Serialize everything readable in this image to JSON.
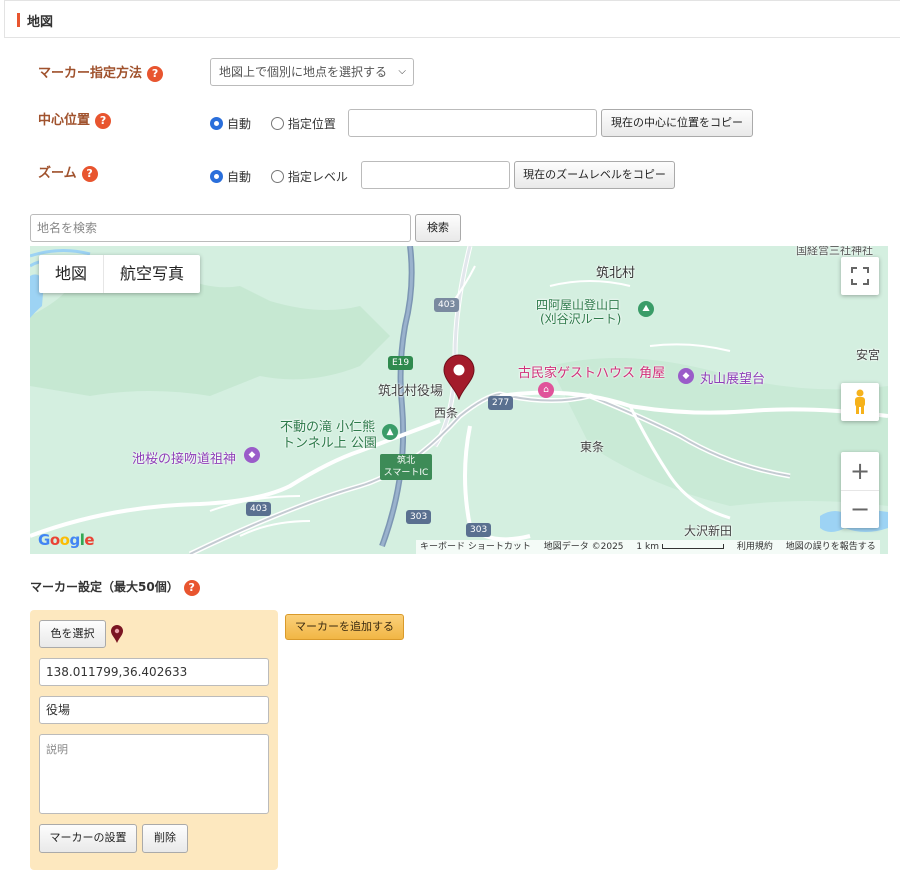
{
  "section": {
    "title": "地図"
  },
  "marker_method": {
    "label": "マーカー指定方法",
    "help": "?",
    "selected": "地図上で個別に地点を選択する"
  },
  "center": {
    "label": "中心位置",
    "help": "?",
    "option_auto": "自動",
    "option_fixed": "指定位置",
    "selected": "自動",
    "value": "",
    "copy_button": "現在の中心に位置をコピー"
  },
  "zoom": {
    "label": "ズーム",
    "help": "?",
    "option_auto": "自動",
    "option_level": "指定レベル",
    "selected": "自動",
    "value": "",
    "copy_button": "現在のズームレベルをコピー"
  },
  "search": {
    "placeholder": "地名を検索",
    "button": "検索"
  },
  "map": {
    "type_map": "地図",
    "type_satellite": "航空写真",
    "zoom_in": "+",
    "zoom_out": "−",
    "labels": {
      "chikuhoku": "筑北村",
      "shiazaya": "四阿屋山登山口",
      "shiazaya2": "(刈谷沢ルート)",
      "kominka": "古民家ゲストハウス 角屋",
      "maruyama": "丸山展望台",
      "yakuba": "筑北村役場",
      "nishijo": "西条",
      "fudo1": "不動の滝 小仁熊",
      "fudo2": "トンネル上 公園",
      "ikezakura": "池桜の接吻道祖神",
      "tojo": "東条",
      "osawa": "大沢新田",
      "ankyu": "安宮",
      "top_right": "国経営三社神社",
      "ic1": "筑北",
      "ic2": "スマートIC"
    },
    "roads": [
      "403",
      "E19",
      "277",
      "403",
      "303",
      "303"
    ],
    "attribution": {
      "keyboard": "キーボード ショートカット",
      "data": "地図データ ©2025",
      "scale": "1 km",
      "terms": "利用規約",
      "report": "地図の誤りを報告する"
    },
    "logo": "Google",
    "colors": {
      "pin": "#a31b2b",
      "land": "#d4efe0",
      "water": "#9dd3f4",
      "highway": "#8aa0b8"
    }
  },
  "marker_settings": {
    "heading": "マーカー設定（最大50個）",
    "help": "?",
    "color_button": "色を選択",
    "coords": "138.011799,36.402633",
    "name": "役場",
    "description_placeholder": "説明",
    "place_button": "マーカーの設置",
    "delete_button": "削除",
    "add_button": "マーカーを追加する"
  }
}
